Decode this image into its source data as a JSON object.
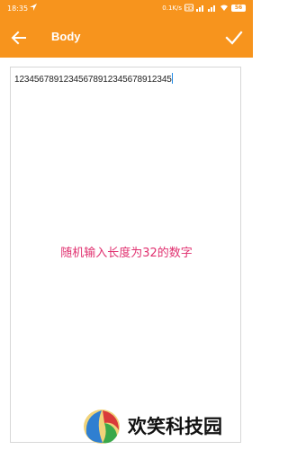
{
  "status_bar": {
    "time": "18:35",
    "network_speed": "0.1K/s",
    "battery": "56"
  },
  "toolbar": {
    "title": "Body",
    "background_color": "#f7941d",
    "back_icon": "arrow-left-icon",
    "confirm_icon": "checkmark-icon"
  },
  "editor": {
    "value": "12345678912345678912345678912345",
    "cursor_color": "#1e88e5"
  },
  "annotation": {
    "text": "随机输入长度为32的数字",
    "color": "#e0306f"
  },
  "watermark": {
    "text": "欢笑科技园"
  }
}
